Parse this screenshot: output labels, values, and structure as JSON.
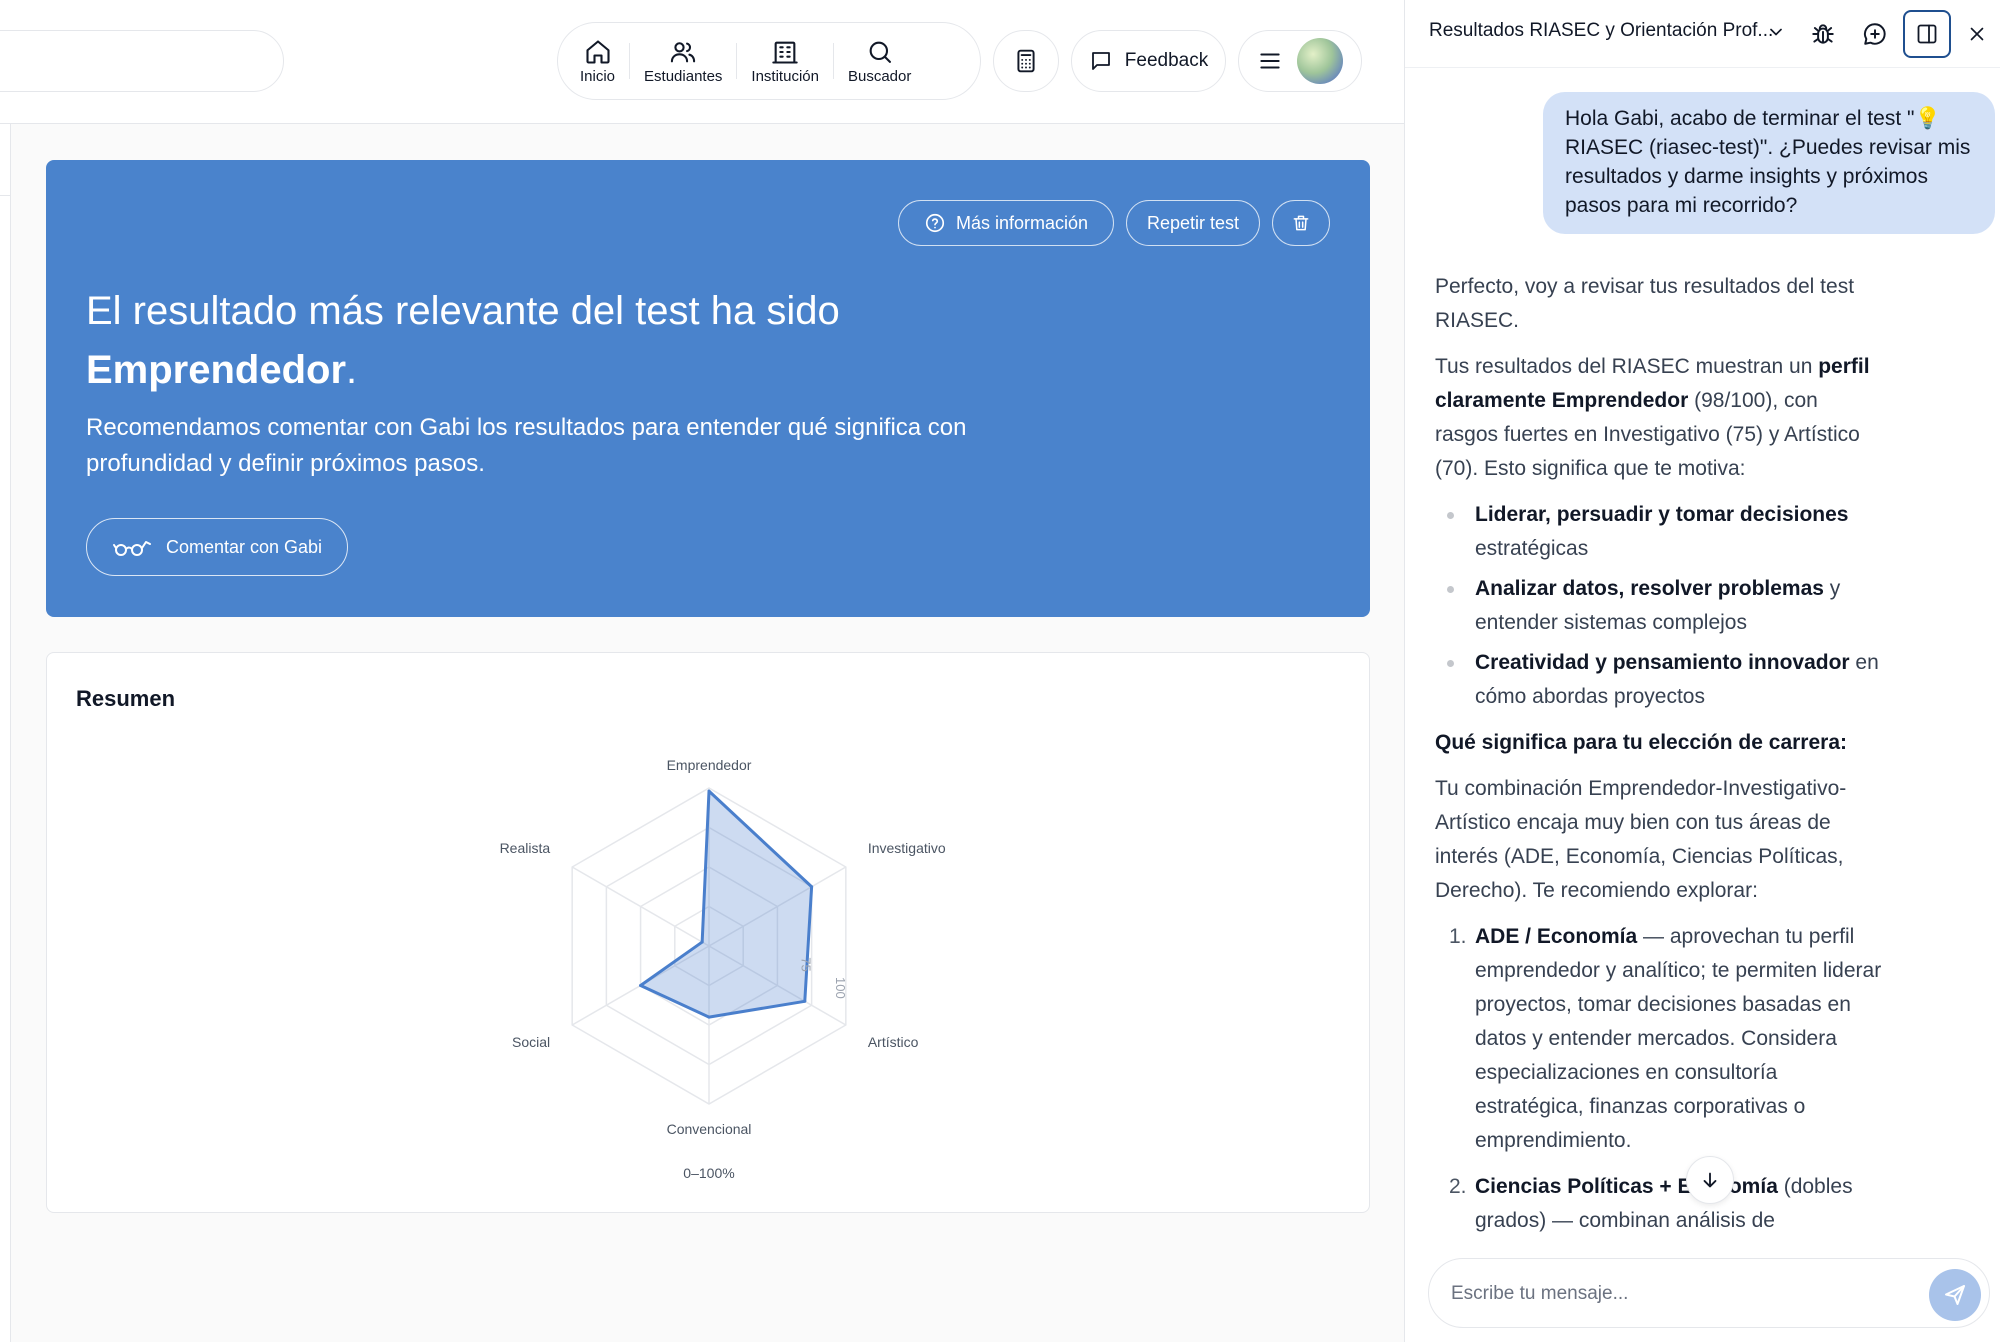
{
  "nav": {
    "items": [
      {
        "label": "Inicio",
        "icon": "home-icon"
      },
      {
        "label": "Estudiantes",
        "icon": "users-icon"
      },
      {
        "label": "Institución",
        "icon": "building-icon"
      },
      {
        "label": "Buscador",
        "icon": "search-icon"
      }
    ],
    "feedback_label": "Feedback"
  },
  "hero": {
    "more_info_label": "Más información",
    "repeat_label": "Repetir test",
    "title_prefix": "El resultado más relevante del test ha sido",
    "title_result": "Emprendedor",
    "title_suffix": ".",
    "subtitle": "Recomendamos comentar con Gabi los resultados para entender qué significa con profundidad y definir próximos pasos.",
    "comment_label": "Comentar con Gabi",
    "background": "#4a83cc"
  },
  "summary": {
    "title": "Resumen",
    "caption": "0–100%"
  },
  "chart_data": {
    "type": "radar",
    "categories": [
      "Emprendedor",
      "Investigativo",
      "Artístico",
      "Convencional",
      "Social",
      "Realista"
    ],
    "series": [
      {
        "values": [
          98,
          75,
          70,
          45,
          50,
          5
        ],
        "color": "#4a7fcc"
      }
    ],
    "rlim": [
      0,
      100
    ],
    "ticks": [
      "75",
      "100"
    ],
    "caption": "0–100%"
  },
  "chat": {
    "title": "Resultados RIASEC y Orientación Prof...",
    "user_message": "Hola Gabi, acabo de terminar el test \"💡 RIASEC (riasec-test)\". ¿Puedes revisar mis resultados y darme insights y próximos pasos para mi recorrido?",
    "p1": "Perfecto, voy a revisar tus resultados del test RIASEC.",
    "p2_a": "Tus resultados del RIASEC muestran un ",
    "p2_b": "perfil claramente Emprendedor",
    "p2_c": " (98/100), con rasgos fuertes en Investigativo (75) y Artístico (70). Esto significa que te motiva:",
    "bullets": [
      {
        "bold": "Liderar, persuadir y tomar decisiones",
        "rest": " estratégicas"
      },
      {
        "bold": "Analizar datos, resolver problemas",
        "rest": " y entender sistemas complejos"
      },
      {
        "bold": "Creatividad y pensamiento innovador",
        "rest": " en cómo abordas proyectos"
      }
    ],
    "heading": "Qué significa para tu elección de carrera:",
    "p3": "Tu combinación Emprendedor-Investigativo-Artístico encaja muy bien con tus áreas de interés (ADE, Economía, Ciencias Políticas, Derecho). Te recomiendo explorar:",
    "numbered": [
      {
        "num": "1.",
        "bold": "ADE / Economía",
        "rest": " — aprovechan tu perfil emprendedor y analítico; te permiten liderar proyectos, tomar decisiones basadas en datos y entender mercados. Considera especializaciones en consultoría estratégica, finanzas corporativas o emprendimiento."
      },
      {
        "num": "2.",
        "bold": "Ciencias Políticas + Economía",
        "rest": " (dobles grados) — combinan análisis de"
      }
    ],
    "input_placeholder": "Escribe tu mensaje..."
  }
}
